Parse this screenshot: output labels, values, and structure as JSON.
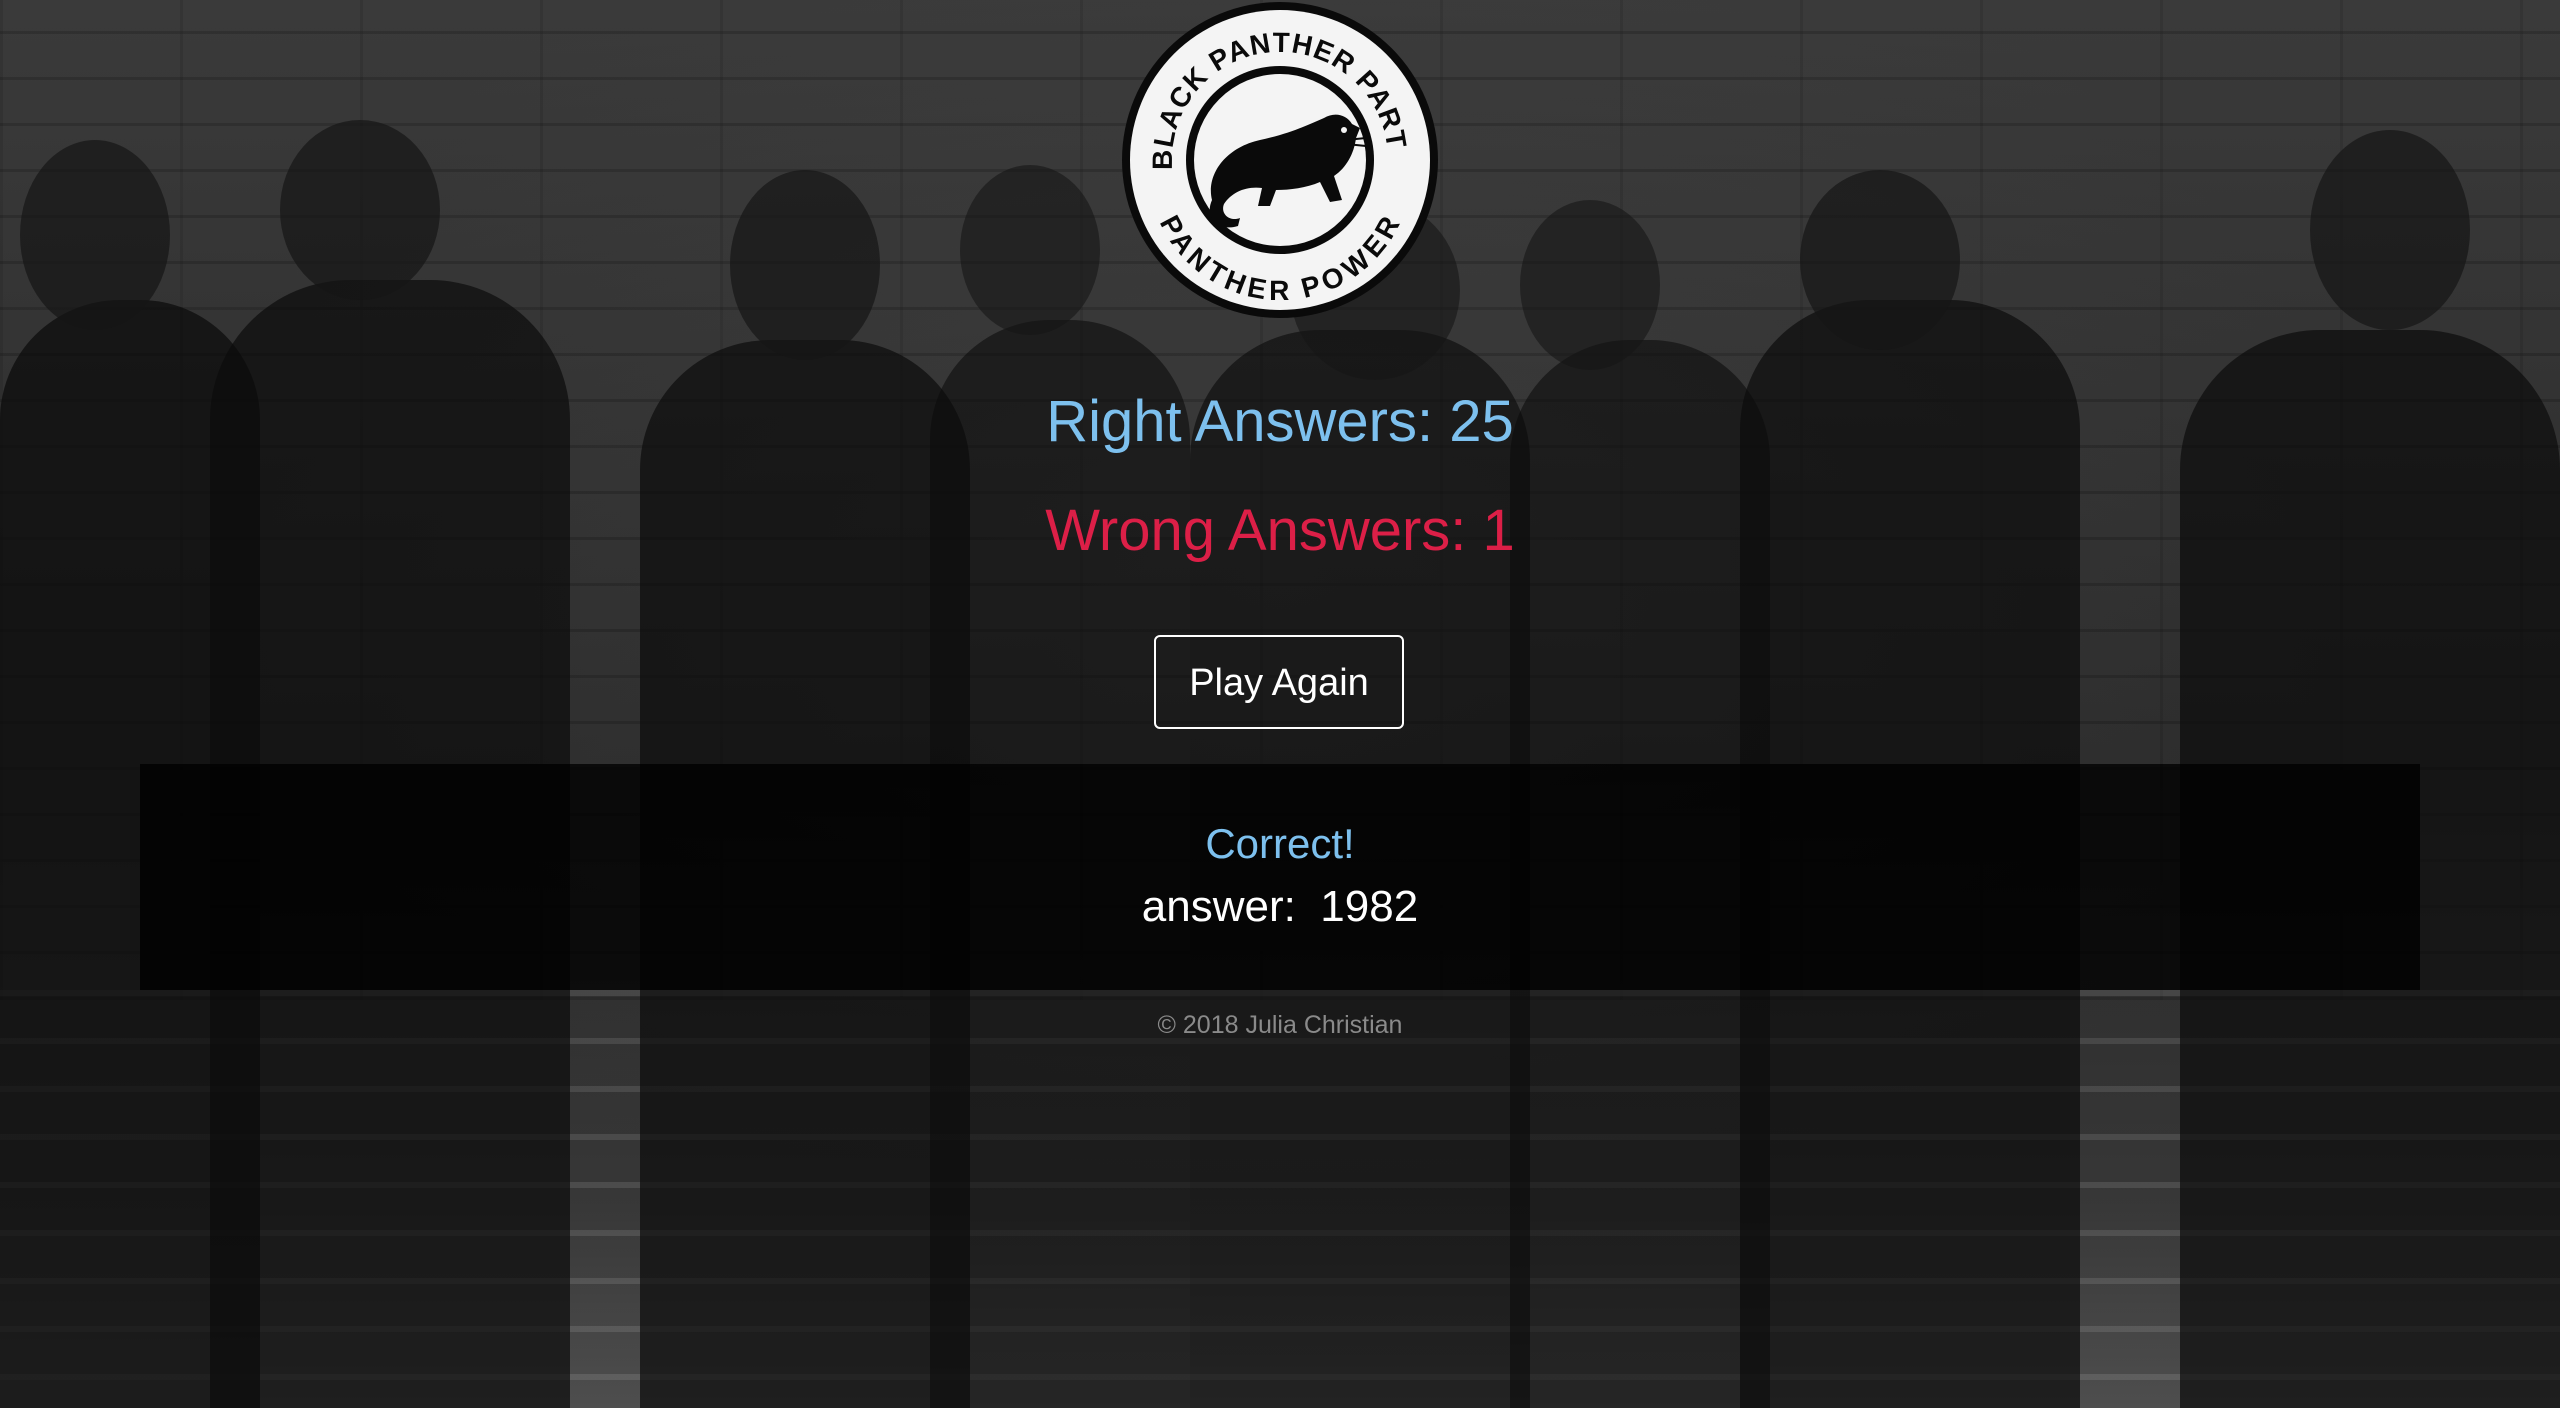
{
  "logo": {
    "top_text": "BLACK PANTHER PARTY",
    "bottom_text": "PANTHER POWER",
    "icon": "panther-icon"
  },
  "score": {
    "right_label": "Right Answers: 25",
    "wrong_label": "Wrong Answers: 1"
  },
  "actions": {
    "play_again_label": "Play Again"
  },
  "result": {
    "status": "Correct!",
    "answer_text": "answer:  1982"
  },
  "footer": {
    "copyright": "© 2018 Julia Christian"
  },
  "colors": {
    "right": "#7dc0ee",
    "wrong": "#dc1f47",
    "panel": "#000000"
  }
}
